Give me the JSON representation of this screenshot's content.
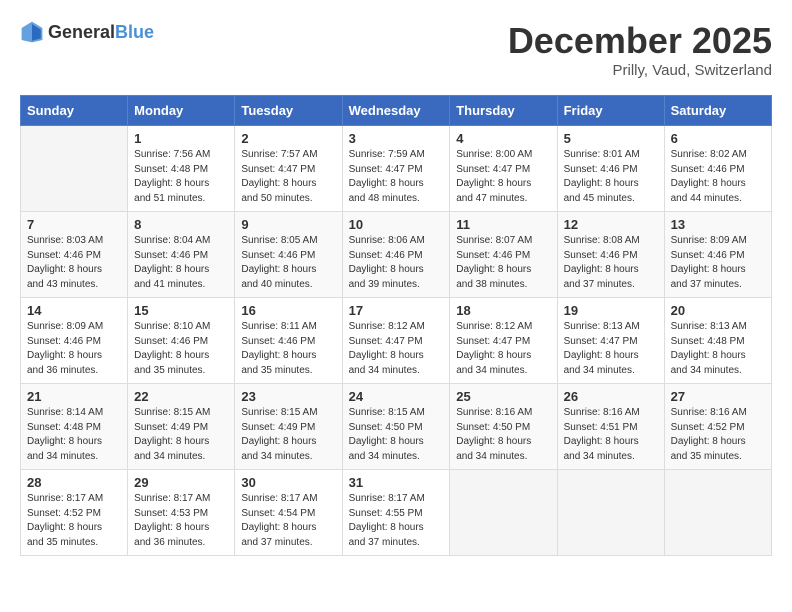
{
  "header": {
    "logo_general": "General",
    "logo_blue": "Blue",
    "month": "December 2025",
    "location": "Prilly, Vaud, Switzerland"
  },
  "weekdays": [
    "Sunday",
    "Monday",
    "Tuesday",
    "Wednesday",
    "Thursday",
    "Friday",
    "Saturday"
  ],
  "weeks": [
    [
      {
        "day": "",
        "info": ""
      },
      {
        "day": "1",
        "info": "Sunrise: 7:56 AM\nSunset: 4:48 PM\nDaylight: 8 hours\nand 51 minutes."
      },
      {
        "day": "2",
        "info": "Sunrise: 7:57 AM\nSunset: 4:47 PM\nDaylight: 8 hours\nand 50 minutes."
      },
      {
        "day": "3",
        "info": "Sunrise: 7:59 AM\nSunset: 4:47 PM\nDaylight: 8 hours\nand 48 minutes."
      },
      {
        "day": "4",
        "info": "Sunrise: 8:00 AM\nSunset: 4:47 PM\nDaylight: 8 hours\nand 47 minutes."
      },
      {
        "day": "5",
        "info": "Sunrise: 8:01 AM\nSunset: 4:46 PM\nDaylight: 8 hours\nand 45 minutes."
      },
      {
        "day": "6",
        "info": "Sunrise: 8:02 AM\nSunset: 4:46 PM\nDaylight: 8 hours\nand 44 minutes."
      }
    ],
    [
      {
        "day": "7",
        "info": "Sunrise: 8:03 AM\nSunset: 4:46 PM\nDaylight: 8 hours\nand 43 minutes."
      },
      {
        "day": "8",
        "info": "Sunrise: 8:04 AM\nSunset: 4:46 PM\nDaylight: 8 hours\nand 41 minutes."
      },
      {
        "day": "9",
        "info": "Sunrise: 8:05 AM\nSunset: 4:46 PM\nDaylight: 8 hours\nand 40 minutes."
      },
      {
        "day": "10",
        "info": "Sunrise: 8:06 AM\nSunset: 4:46 PM\nDaylight: 8 hours\nand 39 minutes."
      },
      {
        "day": "11",
        "info": "Sunrise: 8:07 AM\nSunset: 4:46 PM\nDaylight: 8 hours\nand 38 minutes."
      },
      {
        "day": "12",
        "info": "Sunrise: 8:08 AM\nSunset: 4:46 PM\nDaylight: 8 hours\nand 37 minutes."
      },
      {
        "day": "13",
        "info": "Sunrise: 8:09 AM\nSunset: 4:46 PM\nDaylight: 8 hours\nand 37 minutes."
      }
    ],
    [
      {
        "day": "14",
        "info": "Sunrise: 8:09 AM\nSunset: 4:46 PM\nDaylight: 8 hours\nand 36 minutes."
      },
      {
        "day": "15",
        "info": "Sunrise: 8:10 AM\nSunset: 4:46 PM\nDaylight: 8 hours\nand 35 minutes."
      },
      {
        "day": "16",
        "info": "Sunrise: 8:11 AM\nSunset: 4:46 PM\nDaylight: 8 hours\nand 35 minutes."
      },
      {
        "day": "17",
        "info": "Sunrise: 8:12 AM\nSunset: 4:47 PM\nDaylight: 8 hours\nand 34 minutes."
      },
      {
        "day": "18",
        "info": "Sunrise: 8:12 AM\nSunset: 4:47 PM\nDaylight: 8 hours\nand 34 minutes."
      },
      {
        "day": "19",
        "info": "Sunrise: 8:13 AM\nSunset: 4:47 PM\nDaylight: 8 hours\nand 34 minutes."
      },
      {
        "day": "20",
        "info": "Sunrise: 8:13 AM\nSunset: 4:48 PM\nDaylight: 8 hours\nand 34 minutes."
      }
    ],
    [
      {
        "day": "21",
        "info": "Sunrise: 8:14 AM\nSunset: 4:48 PM\nDaylight: 8 hours\nand 34 minutes."
      },
      {
        "day": "22",
        "info": "Sunrise: 8:15 AM\nSunset: 4:49 PM\nDaylight: 8 hours\nand 34 minutes."
      },
      {
        "day": "23",
        "info": "Sunrise: 8:15 AM\nSunset: 4:49 PM\nDaylight: 8 hours\nand 34 minutes."
      },
      {
        "day": "24",
        "info": "Sunrise: 8:15 AM\nSunset: 4:50 PM\nDaylight: 8 hours\nand 34 minutes."
      },
      {
        "day": "25",
        "info": "Sunrise: 8:16 AM\nSunset: 4:50 PM\nDaylight: 8 hours\nand 34 minutes."
      },
      {
        "day": "26",
        "info": "Sunrise: 8:16 AM\nSunset: 4:51 PM\nDaylight: 8 hours\nand 34 minutes."
      },
      {
        "day": "27",
        "info": "Sunrise: 8:16 AM\nSunset: 4:52 PM\nDaylight: 8 hours\nand 35 minutes."
      }
    ],
    [
      {
        "day": "28",
        "info": "Sunrise: 8:17 AM\nSunset: 4:52 PM\nDaylight: 8 hours\nand 35 minutes."
      },
      {
        "day": "29",
        "info": "Sunrise: 8:17 AM\nSunset: 4:53 PM\nDaylight: 8 hours\nand 36 minutes."
      },
      {
        "day": "30",
        "info": "Sunrise: 8:17 AM\nSunset: 4:54 PM\nDaylight: 8 hours\nand 37 minutes."
      },
      {
        "day": "31",
        "info": "Sunrise: 8:17 AM\nSunset: 4:55 PM\nDaylight: 8 hours\nand 37 minutes."
      },
      {
        "day": "",
        "info": ""
      },
      {
        "day": "",
        "info": ""
      },
      {
        "day": "",
        "info": ""
      }
    ]
  ]
}
